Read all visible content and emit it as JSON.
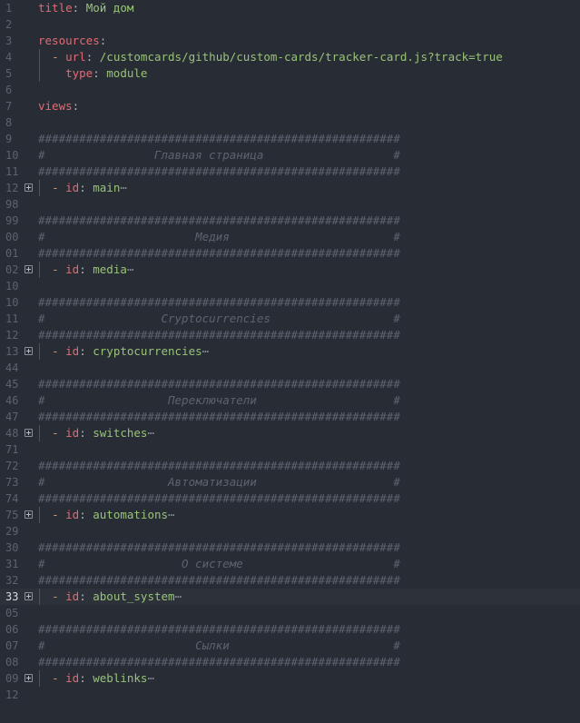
{
  "editor": {
    "lines": [
      {
        "num": "1",
        "tokens": [
          {
            "t": "title",
            "c": "key"
          },
          {
            "t": ": ",
            "c": "punc"
          },
          {
            "t": "Мой дом",
            "c": "str"
          }
        ]
      },
      {
        "num": "2",
        "tokens": []
      },
      {
        "num": "3",
        "tokens": [
          {
            "t": "resources",
            "c": "key"
          },
          {
            "t": ":",
            "c": "punc"
          }
        ]
      },
      {
        "num": "4",
        "tokens": [
          {
            "t": "  ",
            "c": "punc"
          },
          {
            "t": "-",
            "c": "dash"
          },
          {
            "t": " ",
            "c": "punc"
          },
          {
            "t": "url",
            "c": "key"
          },
          {
            "t": ": ",
            "c": "punc"
          },
          {
            "t": "/customcards/github/custom-cards/tracker-card.js?track=true",
            "c": "str"
          }
        ]
      },
      {
        "num": "5",
        "tokens": [
          {
            "t": "    ",
            "c": "punc"
          },
          {
            "t": "type",
            "c": "key"
          },
          {
            "t": ": ",
            "c": "punc"
          },
          {
            "t": "module",
            "c": "str"
          }
        ]
      },
      {
        "num": "6",
        "tokens": []
      },
      {
        "num": "7",
        "tokens": [
          {
            "t": "views",
            "c": "key"
          },
          {
            "t": ":",
            "c": "punc"
          }
        ]
      },
      {
        "num": "8",
        "tokens": []
      },
      {
        "num": "9",
        "tokens": [
          {
            "t": "#####################################################",
            "c": "comment"
          }
        ]
      },
      {
        "num": "10",
        "tokens": [
          {
            "t": "#                Главная страница                   #",
            "c": "comment-i"
          }
        ]
      },
      {
        "num": "11",
        "tokens": [
          {
            "t": "#####################################################",
            "c": "comment"
          }
        ]
      },
      {
        "num": "12",
        "fold": true,
        "tokens": [
          {
            "t": "  ",
            "c": "punc"
          },
          {
            "t": "-",
            "c": "dash"
          },
          {
            "t": " ",
            "c": "punc"
          },
          {
            "t": "id",
            "c": "key"
          },
          {
            "t": ": ",
            "c": "punc"
          },
          {
            "t": "main",
            "c": "str"
          },
          {
            "t": "⋯",
            "c": "ellipsis"
          }
        ]
      },
      {
        "num": "98",
        "tokens": []
      },
      {
        "num": "99",
        "tokens": [
          {
            "t": "#####################################################",
            "c": "comment"
          }
        ]
      },
      {
        "num": "00",
        "tokens": [
          {
            "t": "#                      Медия                        #",
            "c": "comment-i"
          }
        ]
      },
      {
        "num": "01",
        "tokens": [
          {
            "t": "#####################################################",
            "c": "comment"
          }
        ]
      },
      {
        "num": "02",
        "fold": true,
        "tokens": [
          {
            "t": "  ",
            "c": "punc"
          },
          {
            "t": "-",
            "c": "dash"
          },
          {
            "t": " ",
            "c": "punc"
          },
          {
            "t": "id",
            "c": "key"
          },
          {
            "t": ": ",
            "c": "punc"
          },
          {
            "t": "media",
            "c": "str"
          },
          {
            "t": "⋯",
            "c": "ellipsis"
          }
        ]
      },
      {
        "num": "10",
        "tokens": []
      },
      {
        "num": "10",
        "tokens": [
          {
            "t": "#####################################################",
            "c": "comment"
          }
        ]
      },
      {
        "num": "11",
        "tokens": [
          {
            "t": "#                 Cryptocurrencies                  #",
            "c": "comment-i"
          }
        ]
      },
      {
        "num": "12",
        "tokens": [
          {
            "t": "#####################################################",
            "c": "comment"
          }
        ]
      },
      {
        "num": "13",
        "fold": true,
        "tokens": [
          {
            "t": "  ",
            "c": "punc"
          },
          {
            "t": "-",
            "c": "dash"
          },
          {
            "t": " ",
            "c": "punc"
          },
          {
            "t": "id",
            "c": "key"
          },
          {
            "t": ": ",
            "c": "punc"
          },
          {
            "t": "cryptocurrencies",
            "c": "str"
          },
          {
            "t": "⋯",
            "c": "ellipsis"
          }
        ]
      },
      {
        "num": "44",
        "tokens": []
      },
      {
        "num": "45",
        "tokens": [
          {
            "t": "#####################################################",
            "c": "comment"
          }
        ]
      },
      {
        "num": "46",
        "tokens": [
          {
            "t": "#                  Переключатели                    #",
            "c": "comment-i"
          }
        ]
      },
      {
        "num": "47",
        "tokens": [
          {
            "t": "#####################################################",
            "c": "comment"
          }
        ]
      },
      {
        "num": "48",
        "fold": true,
        "tokens": [
          {
            "t": "  ",
            "c": "punc"
          },
          {
            "t": "-",
            "c": "dash"
          },
          {
            "t": " ",
            "c": "punc"
          },
          {
            "t": "id",
            "c": "key"
          },
          {
            "t": ": ",
            "c": "punc"
          },
          {
            "t": "switches",
            "c": "str"
          },
          {
            "t": "⋯",
            "c": "ellipsis"
          }
        ]
      },
      {
        "num": "71",
        "tokens": []
      },
      {
        "num": "72",
        "tokens": [
          {
            "t": "#####################################################",
            "c": "comment"
          }
        ]
      },
      {
        "num": "73",
        "tokens": [
          {
            "t": "#                  Автоматизации                    #",
            "c": "comment-i"
          }
        ]
      },
      {
        "num": "74",
        "tokens": [
          {
            "t": "#####################################################",
            "c": "comment"
          }
        ]
      },
      {
        "num": "75",
        "fold": true,
        "tokens": [
          {
            "t": "  ",
            "c": "punc"
          },
          {
            "t": "-",
            "c": "dash"
          },
          {
            "t": " ",
            "c": "punc"
          },
          {
            "t": "id",
            "c": "key"
          },
          {
            "t": ": ",
            "c": "punc"
          },
          {
            "t": "automations",
            "c": "str"
          },
          {
            "t": "⋯",
            "c": "ellipsis"
          }
        ]
      },
      {
        "num": "29",
        "tokens": []
      },
      {
        "num": "30",
        "tokens": [
          {
            "t": "#####################################################",
            "c": "comment"
          }
        ]
      },
      {
        "num": "31",
        "tokens": [
          {
            "t": "#                    О системе                      #",
            "c": "comment-i"
          }
        ]
      },
      {
        "num": "32",
        "tokens": [
          {
            "t": "#####################################################",
            "c": "comment"
          }
        ]
      },
      {
        "num": "33",
        "fold": true,
        "active": true,
        "tokens": [
          {
            "t": "  ",
            "c": "punc"
          },
          {
            "t": "-",
            "c": "dash"
          },
          {
            "t": " ",
            "c": "punc"
          },
          {
            "t": "id",
            "c": "key"
          },
          {
            "t": ": ",
            "c": "punc"
          },
          {
            "t": "about_system",
            "c": "str"
          },
          {
            "t": "⋯",
            "c": "ellipsis"
          }
        ]
      },
      {
        "num": "05",
        "tokens": []
      },
      {
        "num": "06",
        "tokens": [
          {
            "t": "#####################################################",
            "c": "comment"
          }
        ]
      },
      {
        "num": "07",
        "tokens": [
          {
            "t": "#                      Сылки                        #",
            "c": "comment-i"
          }
        ]
      },
      {
        "num": "08",
        "tokens": [
          {
            "t": "#####################################################",
            "c": "comment"
          }
        ]
      },
      {
        "num": "09",
        "fold": true,
        "tokens": [
          {
            "t": "  ",
            "c": "punc"
          },
          {
            "t": "-",
            "c": "dash"
          },
          {
            "t": " ",
            "c": "punc"
          },
          {
            "t": "id",
            "c": "key"
          },
          {
            "t": ": ",
            "c": "punc"
          },
          {
            "t": "weblinks",
            "c": "str"
          },
          {
            "t": "⋯",
            "c": "ellipsis"
          }
        ]
      },
      {
        "num": "12",
        "tokens": []
      }
    ]
  }
}
